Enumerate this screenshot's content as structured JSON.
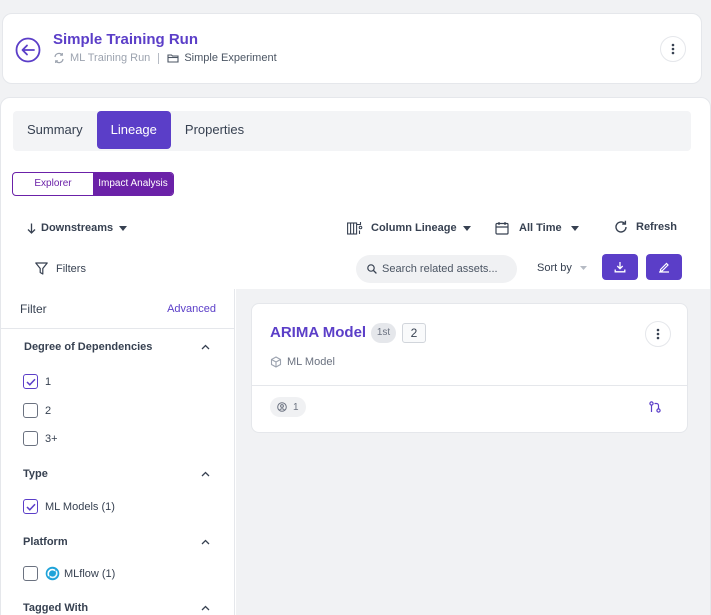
{
  "header": {
    "title": "Simple Training Run",
    "entity_type": "ML Training Run",
    "parent": "Simple Experiment"
  },
  "tabs": [
    {
      "label": "Summary",
      "active": false
    },
    {
      "label": "Lineage",
      "active": true
    },
    {
      "label": "Properties",
      "active": false
    }
  ],
  "view_toggle": {
    "options": [
      "Explorer",
      "Impact Analysis"
    ],
    "selected": "Impact Analysis"
  },
  "toolbar": {
    "direction": "Downstreams",
    "column_lineage": "Column Lineage",
    "time_range": "All Time",
    "refresh": "Refresh",
    "filters": "Filters",
    "search_placeholder": "Search related assets...",
    "sort_by": "Sort by",
    "download_icon": "download-icon",
    "edit_icon": "edit-icon"
  },
  "filter_panel": {
    "title": "Filter",
    "advanced": "Advanced",
    "sections": {
      "degree": {
        "title": "Degree of Dependencies",
        "options": [
          {
            "label": "1",
            "checked": true
          },
          {
            "label": "2",
            "checked": false
          },
          {
            "label": "3+",
            "checked": false
          }
        ]
      },
      "type": {
        "title": "Type",
        "options": [
          {
            "label": "ML Models (1)",
            "checked": true
          }
        ]
      },
      "platform": {
        "title": "Platform",
        "options": [
          {
            "label": "MLflow (1)",
            "checked": false,
            "icon": "mlflow-logo"
          }
        ]
      },
      "tagged": {
        "title": "Tagged With"
      }
    }
  },
  "results": [
    {
      "name": "ARIMA Model",
      "degree_badge": "1st",
      "count": "2",
      "type": "ML Model",
      "owners": "1"
    }
  ],
  "colors": {
    "accent": "#5b3ec8",
    "toggle": "#6b21a8",
    "background": "#f1f2f4"
  }
}
